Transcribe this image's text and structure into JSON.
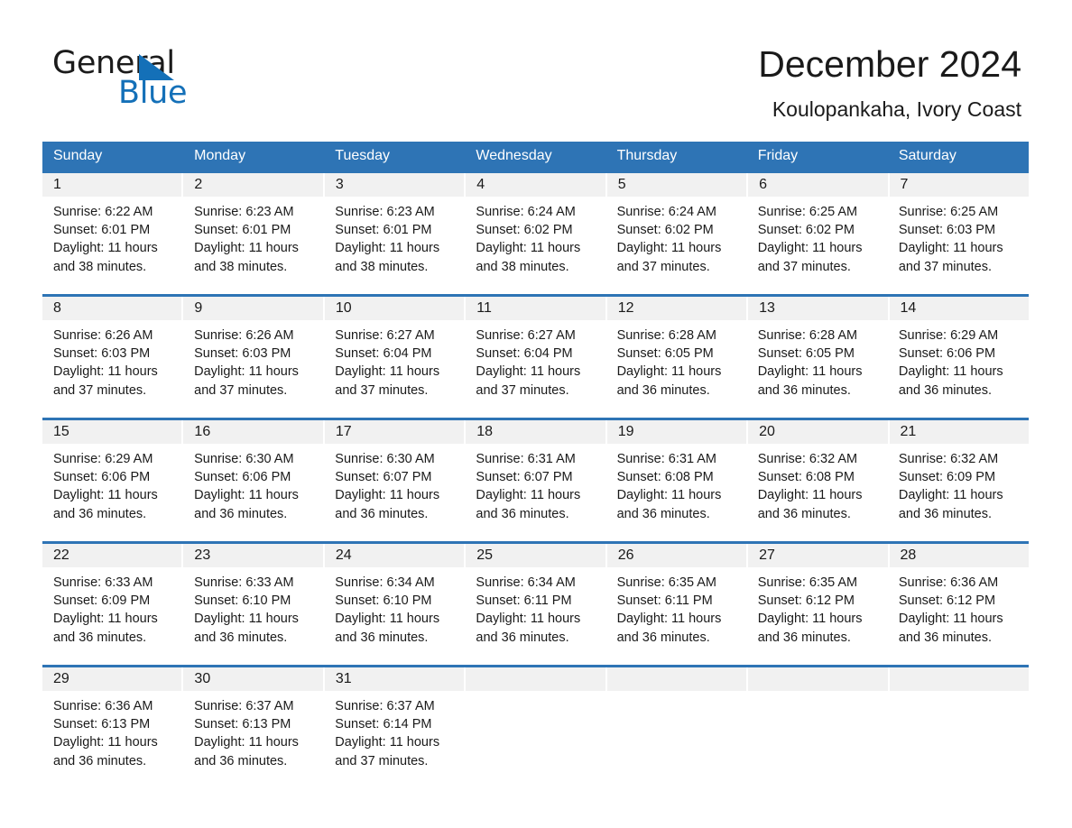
{
  "brand": {
    "logo_primary": "General",
    "logo_secondary": "Blue",
    "logo_mark": "triangle-icon",
    "accent_color": "#1470b8"
  },
  "header": {
    "title": "December 2024",
    "subtitle": "Koulopankaha, Ivory Coast"
  },
  "colors": {
    "header_blue": "#2e74b5",
    "row_divider_blue": "#2e74b5",
    "date_band_gray": "#f1f1f1",
    "text": "#1a1a1a"
  },
  "calendar": {
    "weekdays": [
      "Sunday",
      "Monday",
      "Tuesday",
      "Wednesday",
      "Thursday",
      "Friday",
      "Saturday"
    ],
    "weeks": [
      {
        "days": [
          {
            "date": "1",
            "sunrise": "Sunrise: 6:22 AM",
            "sunset": "Sunset: 6:01 PM",
            "daylight_1": "Daylight: 11 hours",
            "daylight_2": "and 38 minutes."
          },
          {
            "date": "2",
            "sunrise": "Sunrise: 6:23 AM",
            "sunset": "Sunset: 6:01 PM",
            "daylight_1": "Daylight: 11 hours",
            "daylight_2": "and 38 minutes."
          },
          {
            "date": "3",
            "sunrise": "Sunrise: 6:23 AM",
            "sunset": "Sunset: 6:01 PM",
            "daylight_1": "Daylight: 11 hours",
            "daylight_2": "and 38 minutes."
          },
          {
            "date": "4",
            "sunrise": "Sunrise: 6:24 AM",
            "sunset": "Sunset: 6:02 PM",
            "daylight_1": "Daylight: 11 hours",
            "daylight_2": "and 38 minutes."
          },
          {
            "date": "5",
            "sunrise": "Sunrise: 6:24 AM",
            "sunset": "Sunset: 6:02 PM",
            "daylight_1": "Daylight: 11 hours",
            "daylight_2": "and 37 minutes."
          },
          {
            "date": "6",
            "sunrise": "Sunrise: 6:25 AM",
            "sunset": "Sunset: 6:02 PM",
            "daylight_1": "Daylight: 11 hours",
            "daylight_2": "and 37 minutes."
          },
          {
            "date": "7",
            "sunrise": "Sunrise: 6:25 AM",
            "sunset": "Sunset: 6:03 PM",
            "daylight_1": "Daylight: 11 hours",
            "daylight_2": "and 37 minutes."
          }
        ]
      },
      {
        "days": [
          {
            "date": "8",
            "sunrise": "Sunrise: 6:26 AM",
            "sunset": "Sunset: 6:03 PM",
            "daylight_1": "Daylight: 11 hours",
            "daylight_2": "and 37 minutes."
          },
          {
            "date": "9",
            "sunrise": "Sunrise: 6:26 AM",
            "sunset": "Sunset: 6:03 PM",
            "daylight_1": "Daylight: 11 hours",
            "daylight_2": "and 37 minutes."
          },
          {
            "date": "10",
            "sunrise": "Sunrise: 6:27 AM",
            "sunset": "Sunset: 6:04 PM",
            "daylight_1": "Daylight: 11 hours",
            "daylight_2": "and 37 minutes."
          },
          {
            "date": "11",
            "sunrise": "Sunrise: 6:27 AM",
            "sunset": "Sunset: 6:04 PM",
            "daylight_1": "Daylight: 11 hours",
            "daylight_2": "and 37 minutes."
          },
          {
            "date": "12",
            "sunrise": "Sunrise: 6:28 AM",
            "sunset": "Sunset: 6:05 PM",
            "daylight_1": "Daylight: 11 hours",
            "daylight_2": "and 36 minutes."
          },
          {
            "date": "13",
            "sunrise": "Sunrise: 6:28 AM",
            "sunset": "Sunset: 6:05 PM",
            "daylight_1": "Daylight: 11 hours",
            "daylight_2": "and 36 minutes."
          },
          {
            "date": "14",
            "sunrise": "Sunrise: 6:29 AM",
            "sunset": "Sunset: 6:06 PM",
            "daylight_1": "Daylight: 11 hours",
            "daylight_2": "and 36 minutes."
          }
        ]
      },
      {
        "days": [
          {
            "date": "15",
            "sunrise": "Sunrise: 6:29 AM",
            "sunset": "Sunset: 6:06 PM",
            "daylight_1": "Daylight: 11 hours",
            "daylight_2": "and 36 minutes."
          },
          {
            "date": "16",
            "sunrise": "Sunrise: 6:30 AM",
            "sunset": "Sunset: 6:06 PM",
            "daylight_1": "Daylight: 11 hours",
            "daylight_2": "and 36 minutes."
          },
          {
            "date": "17",
            "sunrise": "Sunrise: 6:30 AM",
            "sunset": "Sunset: 6:07 PM",
            "daylight_1": "Daylight: 11 hours",
            "daylight_2": "and 36 minutes."
          },
          {
            "date": "18",
            "sunrise": "Sunrise: 6:31 AM",
            "sunset": "Sunset: 6:07 PM",
            "daylight_1": "Daylight: 11 hours",
            "daylight_2": "and 36 minutes."
          },
          {
            "date": "19",
            "sunrise": "Sunrise: 6:31 AM",
            "sunset": "Sunset: 6:08 PM",
            "daylight_1": "Daylight: 11 hours",
            "daylight_2": "and 36 minutes."
          },
          {
            "date": "20",
            "sunrise": "Sunrise: 6:32 AM",
            "sunset": "Sunset: 6:08 PM",
            "daylight_1": "Daylight: 11 hours",
            "daylight_2": "and 36 minutes."
          },
          {
            "date": "21",
            "sunrise": "Sunrise: 6:32 AM",
            "sunset": "Sunset: 6:09 PM",
            "daylight_1": "Daylight: 11 hours",
            "daylight_2": "and 36 minutes."
          }
        ]
      },
      {
        "days": [
          {
            "date": "22",
            "sunrise": "Sunrise: 6:33 AM",
            "sunset": "Sunset: 6:09 PM",
            "daylight_1": "Daylight: 11 hours",
            "daylight_2": "and 36 minutes."
          },
          {
            "date": "23",
            "sunrise": "Sunrise: 6:33 AM",
            "sunset": "Sunset: 6:10 PM",
            "daylight_1": "Daylight: 11 hours",
            "daylight_2": "and 36 minutes."
          },
          {
            "date": "24",
            "sunrise": "Sunrise: 6:34 AM",
            "sunset": "Sunset: 6:10 PM",
            "daylight_1": "Daylight: 11 hours",
            "daylight_2": "and 36 minutes."
          },
          {
            "date": "25",
            "sunrise": "Sunrise: 6:34 AM",
            "sunset": "Sunset: 6:11 PM",
            "daylight_1": "Daylight: 11 hours",
            "daylight_2": "and 36 minutes."
          },
          {
            "date": "26",
            "sunrise": "Sunrise: 6:35 AM",
            "sunset": "Sunset: 6:11 PM",
            "daylight_1": "Daylight: 11 hours",
            "daylight_2": "and 36 minutes."
          },
          {
            "date": "27",
            "sunrise": "Sunrise: 6:35 AM",
            "sunset": "Sunset: 6:12 PM",
            "daylight_1": "Daylight: 11 hours",
            "daylight_2": "and 36 minutes."
          },
          {
            "date": "28",
            "sunrise": "Sunrise: 6:36 AM",
            "sunset": "Sunset: 6:12 PM",
            "daylight_1": "Daylight: 11 hours",
            "daylight_2": "and 36 minutes."
          }
        ]
      },
      {
        "days": [
          {
            "date": "29",
            "sunrise": "Sunrise: 6:36 AM",
            "sunset": "Sunset: 6:13 PM",
            "daylight_1": "Daylight: 11 hours",
            "daylight_2": "and 36 minutes."
          },
          {
            "date": "30",
            "sunrise": "Sunrise: 6:37 AM",
            "sunset": "Sunset: 6:13 PM",
            "daylight_1": "Daylight: 11 hours",
            "daylight_2": "and 36 minutes."
          },
          {
            "date": "31",
            "sunrise": "Sunrise: 6:37 AM",
            "sunset": "Sunset: 6:14 PM",
            "daylight_1": "Daylight: 11 hours",
            "daylight_2": "and 37 minutes."
          },
          {
            "date": "",
            "sunrise": "",
            "sunset": "",
            "daylight_1": "",
            "daylight_2": ""
          },
          {
            "date": "",
            "sunrise": "",
            "sunset": "",
            "daylight_1": "",
            "daylight_2": ""
          },
          {
            "date": "",
            "sunrise": "",
            "sunset": "",
            "daylight_1": "",
            "daylight_2": ""
          },
          {
            "date": "",
            "sunrise": "",
            "sunset": "",
            "daylight_1": "",
            "daylight_2": ""
          }
        ]
      }
    ]
  }
}
